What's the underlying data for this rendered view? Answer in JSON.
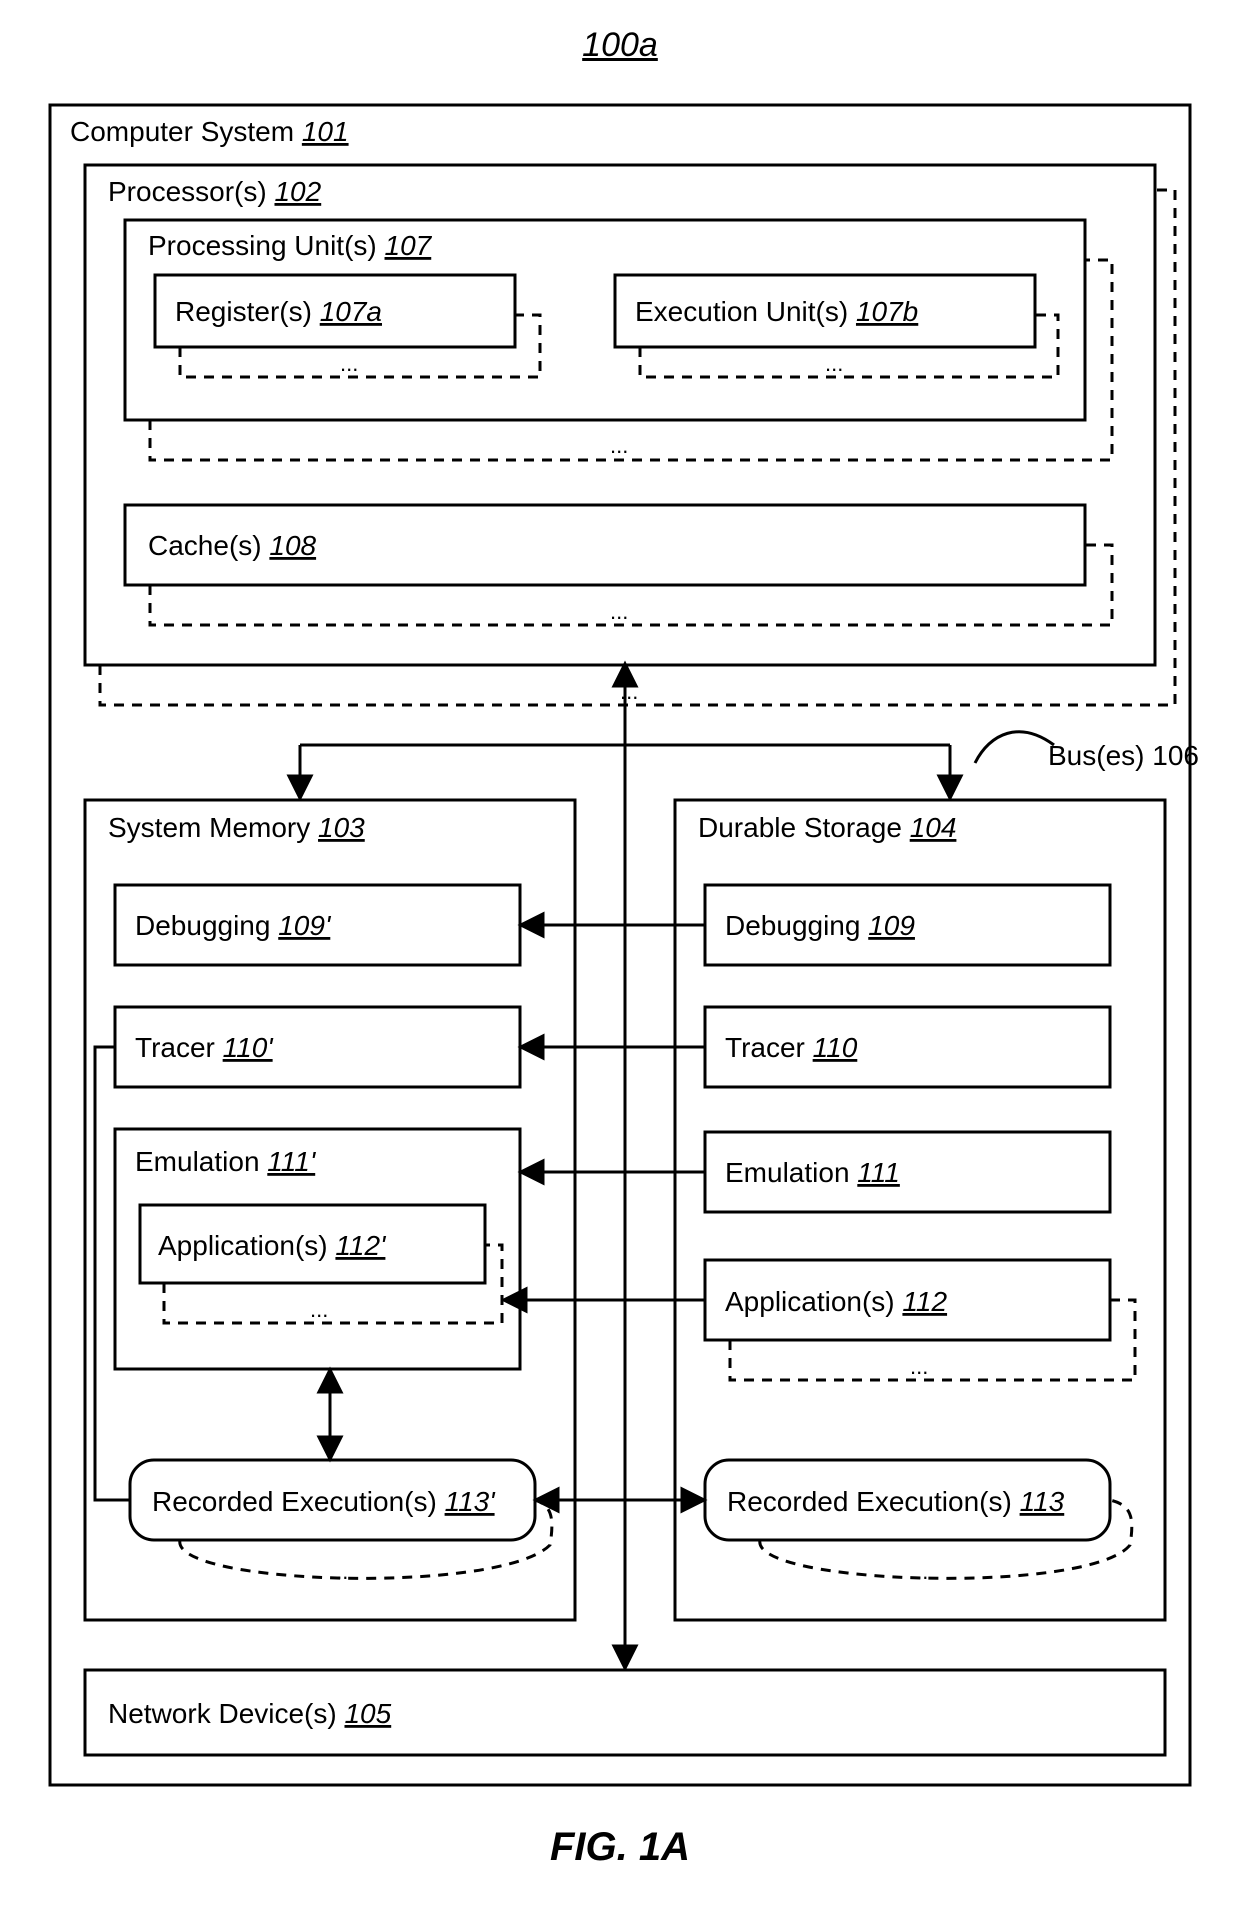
{
  "fig_ref": "100a",
  "fig_caption": "FIG. 1A",
  "bus_label": "Bus(es) 106",
  "computer_system": {
    "name": "Computer System",
    "ref": "101"
  },
  "processors": {
    "name": "Processor(s)",
    "ref": "102"
  },
  "processing_units": {
    "name": "Processing Unit(s)",
    "ref": "107"
  },
  "registers": {
    "name": "Register(s)",
    "ref": "107a"
  },
  "execution_units": {
    "name": "Execution Unit(s)",
    "ref": "107b"
  },
  "caches": {
    "name": "Cache(s)",
    "ref": "108"
  },
  "system_memory": {
    "name": "System Memory",
    "ref": "103"
  },
  "durable_storage": {
    "name": "Durable Storage",
    "ref": "104"
  },
  "debugging_m": {
    "name": "Debugging",
    "ref": "109'"
  },
  "tracer_m": {
    "name": "Tracer",
    "ref": "110'"
  },
  "emulation_m": {
    "name": "Emulation",
    "ref": "111'"
  },
  "applications_m": {
    "name": "Application(s)",
    "ref": "112'"
  },
  "recorded_m": {
    "name": "Recorded Execution(s)",
    "ref": "113'"
  },
  "debugging_s": {
    "name": "Debugging",
    "ref": "109"
  },
  "tracer_s": {
    "name": "Tracer",
    "ref": "110"
  },
  "emulation_s": {
    "name": "Emulation",
    "ref": "111"
  },
  "applications_s": {
    "name": "Application(s)",
    "ref": "112"
  },
  "recorded_s": {
    "name": "Recorded Execution(s)",
    "ref": "113"
  },
  "network": {
    "name": "Network Device(s)",
    "ref": "105"
  },
  "ellipsis": "..."
}
